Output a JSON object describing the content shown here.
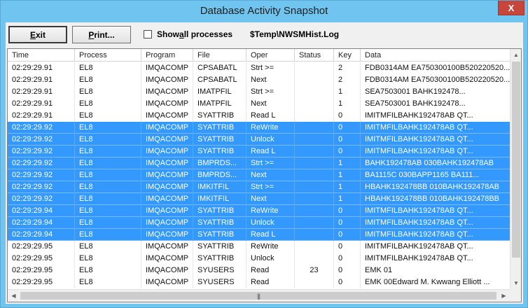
{
  "window": {
    "title": "Database Activity Snapshot",
    "close_glyph": "X"
  },
  "toolbar": {
    "exit_label_hot": "E",
    "exit_label_rest": "xit",
    "print_label_hot": "P",
    "print_label_rest": "rint...",
    "show_all_label_pre": "Show ",
    "show_all_label_hot": "a",
    "show_all_label_post": "ll processes",
    "show_all_checked": false,
    "log_path": "$Temp\\NWSMHist.Log"
  },
  "grid": {
    "columns": [
      "Time",
      "Process",
      "Program",
      "File",
      "Oper",
      "Status",
      "Key",
      "Data"
    ],
    "rows": [
      {
        "time": "02:29:29.91",
        "process": "EL8",
        "program": "IMQACOMP",
        "file": "CPSABATL",
        "oper": "Strt >=",
        "status": "",
        "key": "2",
        "data": "FDB0314AM EA750300100B520220520...",
        "selected": false
      },
      {
        "time": "02:29:29.91",
        "process": "EL8",
        "program": "IMQACOMP",
        "file": "CPSABATL",
        "oper": "Next",
        "status": "",
        "key": "2",
        "data": "FDB0314AM EA750300100B520220520...",
        "selected": false
      },
      {
        "time": "02:29:29.91",
        "process": "EL8",
        "program": "IMQACOMP",
        "file": "IMATPFIL",
        "oper": "Strt >=",
        "status": "",
        "key": "1",
        "data": "SEA7503001            BAHK192478...",
        "selected": false
      },
      {
        "time": "02:29:29.91",
        "process": "EL8",
        "program": "IMQACOMP",
        "file": "IMATPFIL",
        "oper": "Next",
        "status": "",
        "key": "1",
        "data": "SEA7503001            BAHK192478...",
        "selected": false
      },
      {
        "time": "02:29:29.91",
        "process": "EL8",
        "program": "IMQACOMP",
        "file": "SYATTRIB",
        "oper": "Read L",
        "status": "",
        "key": "0",
        "data": "IMITMFILBAHK192478AB          QT...",
        "selected": false
      },
      {
        "time": "02:29:29.92",
        "process": "EL8",
        "program": "IMQACOMP",
        "file": "SYATTRIB",
        "oper": "ReWrite",
        "status": "",
        "key": "0",
        "data": "IMITMFILBAHK192478AB          QT...",
        "selected": true
      },
      {
        "time": "02:29:29.92",
        "process": "EL8",
        "program": "IMQACOMP",
        "file": "SYATTRIB",
        "oper": "Unlock",
        "status": "",
        "key": "0",
        "data": "IMITMFILBAHK192478AB          QT...",
        "selected": true
      },
      {
        "time": "02:29:29.92",
        "process": "EL8",
        "program": "IMQACOMP",
        "file": "SYATTRIB",
        "oper": "Read L",
        "status": "",
        "key": "0",
        "data": "IMITMFILBAHK192478AB          QT...",
        "selected": true
      },
      {
        "time": "02:29:29.92",
        "process": "EL8",
        "program": "IMQACOMP",
        "file": "BMPRDS...",
        "oper": "Strt >=",
        "status": "",
        "key": "1",
        "data": "BAHK192478AB    030BAHK192478AB",
        "selected": true
      },
      {
        "time": "02:29:29.92",
        "process": "EL8",
        "program": "IMQACOMP",
        "file": "BMPRDS...",
        "oper": "Next",
        "status": "",
        "key": "1",
        "data": "BA1115C         030BAPP1165      BA111...",
        "selected": true
      },
      {
        "time": "02:29:29.92",
        "process": "EL8",
        "program": "IMQACOMP",
        "file": "IMKITFIL",
        "oper": "Strt >=",
        "status": "",
        "key": "1",
        "data": "HBAHK192478BB  010BAHK192478AB",
        "selected": true
      },
      {
        "time": "02:29:29.92",
        "process": "EL8",
        "program": "IMQACOMP",
        "file": "IMKITFIL",
        "oper": "Next",
        "status": "",
        "key": "1",
        "data": "HBAHK192478BB  010BAHK192478BB",
        "selected": true
      },
      {
        "time": "02:29:29.94",
        "process": "EL8",
        "program": "IMQACOMP",
        "file": "SYATTRIB",
        "oper": "ReWrite",
        "status": "",
        "key": "0",
        "data": "IMITMFILBAHK192478AB          QT...",
        "selected": true
      },
      {
        "time": "02:29:29.94",
        "process": "EL8",
        "program": "IMQACOMP",
        "file": "SYATTRIB",
        "oper": "Unlock",
        "status": "",
        "key": "0",
        "data": "IMITMFILBAHK192478AB          QT...",
        "selected": true
      },
      {
        "time": "02:29:29.94",
        "process": "EL8",
        "program": "IMQACOMP",
        "file": "SYATTRIB",
        "oper": "Read L",
        "status": "",
        "key": "0",
        "data": "IMITMFILBAHK192478AB          QT...",
        "selected": true
      },
      {
        "time": "02:29:29.95",
        "process": "EL8",
        "program": "IMQACOMP",
        "file": "SYATTRIB",
        "oper": "ReWrite",
        "status": "",
        "key": "0",
        "data": "IMITMFILBAHK192478AB          QT...",
        "selected": false
      },
      {
        "time": "02:29:29.95",
        "process": "EL8",
        "program": "IMQACOMP",
        "file": "SYATTRIB",
        "oper": "Unlock",
        "status": "",
        "key": "0",
        "data": "IMITMFILBAHK192478AB          QT...",
        "selected": false
      },
      {
        "time": "02:29:29.95",
        "process": "EL8",
        "program": "IMQACOMP",
        "file": "SYUSERS",
        "oper": "Read",
        "status": "23",
        "key": "0",
        "data": "EMK        01",
        "selected": false
      },
      {
        "time": "02:29:29.95",
        "process": "EL8",
        "program": "IMQACOMP",
        "file": "SYUSERS",
        "oper": "Read",
        "status": "",
        "key": "0",
        "data": "EMK        00Edward M. Kwwang    Elliott ...",
        "selected": false
      }
    ]
  },
  "scrollbars": {
    "up_icon": "▲",
    "down_icon": "▼",
    "left_icon": "◀",
    "right_icon": "▶",
    "grip": "|||"
  },
  "colors": {
    "title_bar": "#6fc5ef",
    "selection": "#3399ff",
    "close_button": "#c7463b"
  }
}
